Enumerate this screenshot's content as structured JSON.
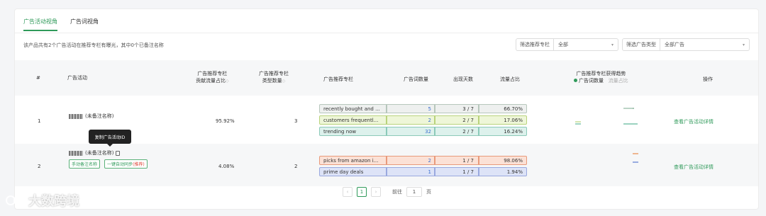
{
  "tabs": [
    "广告活动视角",
    "广告词视角"
  ],
  "summary": "该产品共有2个广告活动在推荐专栏有曝光，其中0个已备注名称",
  "filters": {
    "placement": {
      "label": "筛选推荐专栏",
      "value": "全部"
    },
    "ad_type": {
      "label": "筛选广告类型",
      "value": "全部广告"
    }
  },
  "headers": {
    "index": "#",
    "campaign": "广告活动",
    "traffic_1": "广告推荐专栏",
    "traffic_2": "贡献流量占比",
    "types_1": "广告推荐专栏",
    "types_2": "类型数量",
    "placement": "广告推荐专栏",
    "keyword_count": "广告词数量",
    "days": "出现天数",
    "share": "流量占比",
    "trend": "广告推荐专栏获得趋势",
    "legend_a": "广告词数量",
    "legend_b": "流量占比",
    "action": "操作"
  },
  "rows": [
    {
      "index": "1",
      "name": "(未备注名称)",
      "traffic": "95.92%",
      "types": "3",
      "placements": [
        {
          "name": "recently bought and ...",
          "count": "5",
          "days": "3 / 7",
          "pct": "66.70%"
        },
        {
          "name": "customers frequentl...",
          "count": "2",
          "days": "2 / 7",
          "pct": "17.06%"
        },
        {
          "name": "trending now",
          "count": "32",
          "days": "2 / 7",
          "pct": "16.24%"
        }
      ],
      "action": "查看广告活动详情"
    },
    {
      "index": "2",
      "name": "(未备注名称)",
      "traffic": "4.08%",
      "types": "2",
      "tag_manual": "手动备注名称",
      "tag_sync": "一键自动同步",
      "tag_sync_rec": "(推荐)",
      "placements": [
        {
          "name": "picks from amazon i...",
          "count": "2",
          "days": "1 / 7",
          "pct": "98.06%"
        },
        {
          "name": "prime day deals",
          "count": "1",
          "days": "1 / 7",
          "pct": "1.94%"
        }
      ],
      "action": "查看广告活动详情"
    }
  ],
  "tooltip": "复制广告活动ID",
  "pager": {
    "current": "1",
    "goto_label": "前往",
    "goto_value": "1",
    "page_unit": "页"
  },
  "watermark": "大数跨境",
  "colors": {
    "accent": "#2f9a5a",
    "link": "#3b6fd0"
  },
  "icons": [
    "copy-icon",
    "chevron-left-icon",
    "chevron-right-icon",
    "chevron-down-icon",
    "sort-icon",
    "watermark-logo-icon"
  ]
}
